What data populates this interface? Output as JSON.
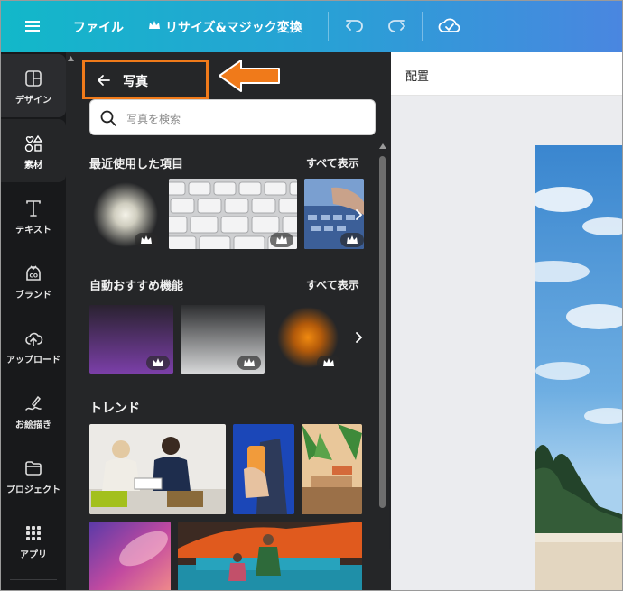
{
  "topbar": {
    "menu_icon": "hamburger-icon",
    "file_label": "ファイル",
    "resize_label": "リサイズ&マジック変換",
    "resize_icon": "crown-icon",
    "undo_icon": "undo-icon",
    "redo_icon": "redo-icon",
    "save_status_icon": "cloud-check-icon",
    "gradient_start": "#12b8c9",
    "gradient_end": "#4a86e0"
  },
  "rail": {
    "items": [
      {
        "label": "デザイン",
        "icon": "layout-icon"
      },
      {
        "label": "素材",
        "icon": "shapes-icon"
      },
      {
        "label": "テキスト",
        "icon": "text-icon"
      },
      {
        "label": "ブランド",
        "icon": "brand-icon"
      },
      {
        "label": "アップロード",
        "icon": "upload-cloud-icon"
      },
      {
        "label": "お絵描き",
        "icon": "draw-icon"
      },
      {
        "label": "プロジェクト",
        "icon": "folder-icon"
      },
      {
        "label": "アプリ",
        "icon": "apps-grid-icon"
      }
    ]
  },
  "panel": {
    "back_title": "写真",
    "highlight_color": "#f07a1a",
    "search_placeholder": "写真を検索",
    "sections": [
      {
        "title": "最近使用した項目",
        "see_all": "すべて表示"
      },
      {
        "title": "自動おすすめ機能",
        "see_all": "すべて表示"
      },
      {
        "title": "トレンド"
      }
    ]
  },
  "canvas": {
    "header_label": "配置"
  },
  "annotation": {
    "arrow_color": "#f07a1a"
  }
}
